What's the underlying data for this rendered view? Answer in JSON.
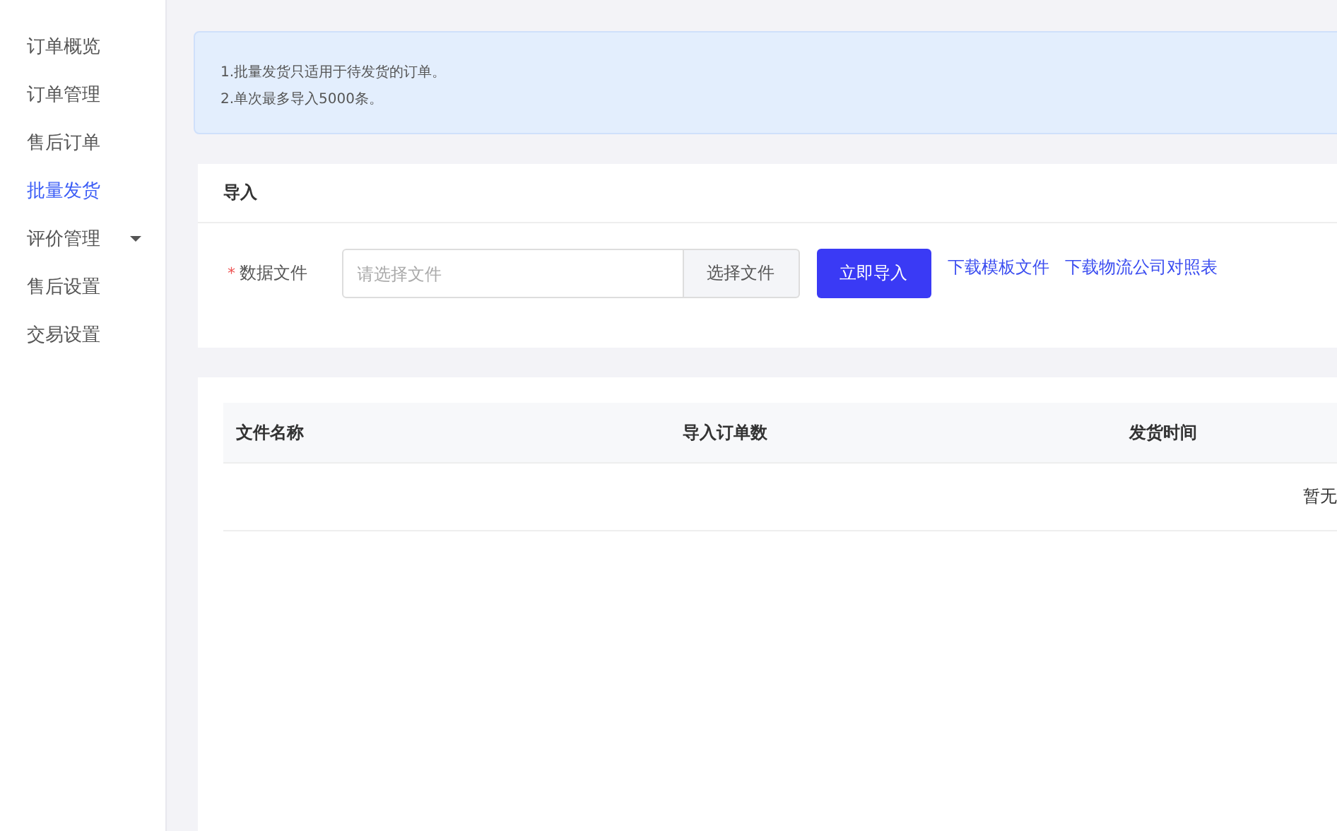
{
  "sidebar": {
    "items": [
      {
        "label": "订单概览",
        "selected": false,
        "expandable": false
      },
      {
        "label": "订单管理",
        "selected": false,
        "expandable": false
      },
      {
        "label": "售后订单",
        "selected": false,
        "expandable": false
      },
      {
        "label": "批量发货",
        "selected": true,
        "expandable": false
      },
      {
        "label": "评价管理",
        "selected": false,
        "expandable": true
      },
      {
        "label": "售后设置",
        "selected": false,
        "expandable": false
      },
      {
        "label": "交易设置",
        "selected": false,
        "expandable": false
      }
    ]
  },
  "notice": [
    "1.批量发货只适用于待发货的订单。",
    "2.单次最多导入5000条。"
  ],
  "import_card": {
    "title": "导入",
    "field_label": "数据文件",
    "required_mark": "*",
    "placeholder": "请选择文件",
    "choose_button": "选择文件",
    "import_button": "立即导入",
    "links": [
      "下载模板文件",
      "下载物流公司对照表"
    ]
  },
  "table": {
    "columns": [
      "文件名称",
      "导入订单数",
      "发货时间"
    ],
    "empty_text": "暂无"
  }
}
